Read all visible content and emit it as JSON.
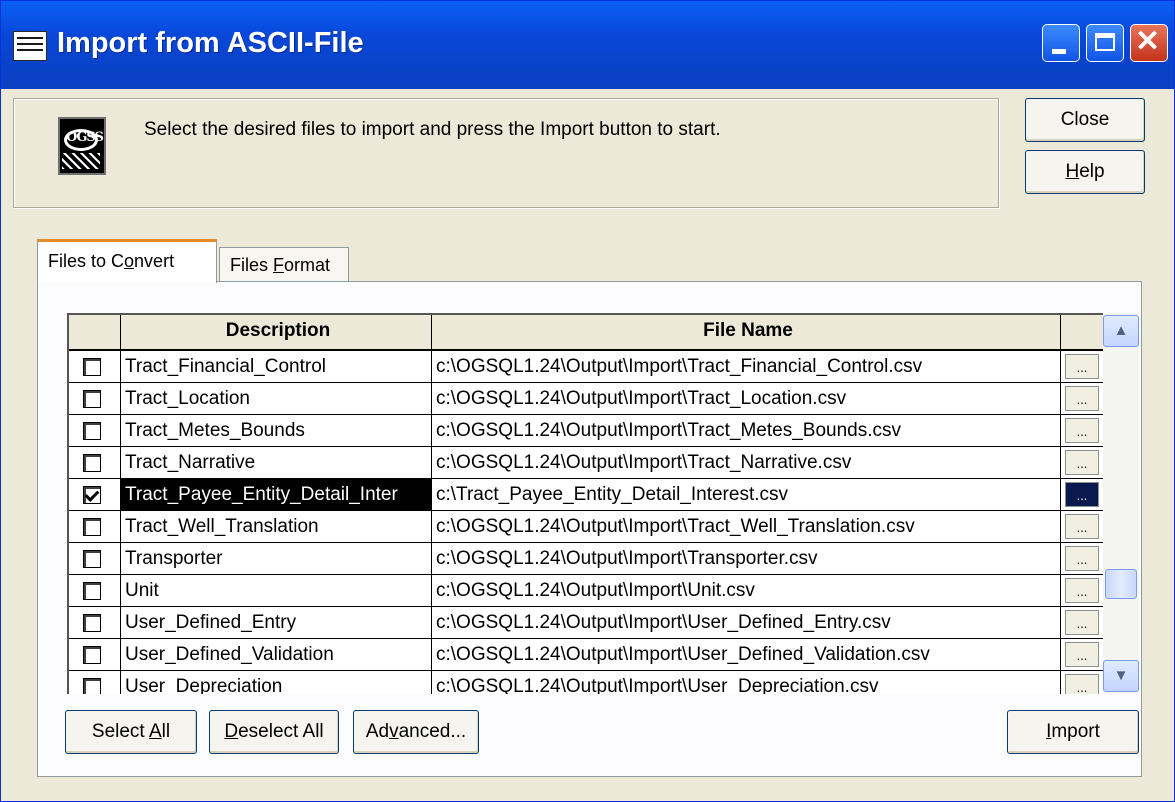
{
  "window": {
    "title": "Import from ASCII-File"
  },
  "instructions": "Select the desired files to import and press the Import button to start.",
  "buttons": {
    "close": "Close",
    "help": "Help",
    "select_all": "Select All",
    "deselect_all": "Deselect All",
    "advanced": "Advanced...",
    "import": "Import"
  },
  "tabs": [
    {
      "label": "Files to Convert",
      "active": true
    },
    {
      "label": "Files Format",
      "active": false
    }
  ],
  "table": {
    "headers": {
      "check": "",
      "description": "Description",
      "file_name": "File Name",
      "browse": ""
    },
    "browse_label": "...",
    "rows": [
      {
        "checked": false,
        "description": "Tract_Financial_Control",
        "file": "c:\\OGSQL1.24\\Output\\Import\\Tract_Financial_Control.csv",
        "selected": false
      },
      {
        "checked": false,
        "description": "Tract_Location",
        "file": "c:\\OGSQL1.24\\Output\\Import\\Tract_Location.csv",
        "selected": false
      },
      {
        "checked": false,
        "description": "Tract_Metes_Bounds",
        "file": "c:\\OGSQL1.24\\Output\\Import\\Tract_Metes_Bounds.csv",
        "selected": false
      },
      {
        "checked": false,
        "description": "Tract_Narrative",
        "file": "c:\\OGSQL1.24\\Output\\Import\\Tract_Narrative.csv",
        "selected": false
      },
      {
        "checked": true,
        "description": "Tract_Payee_Entity_Detail_Inter",
        "file": "c:\\Tract_Payee_Entity_Detail_Interest.csv",
        "selected": true
      },
      {
        "checked": false,
        "description": "Tract_Well_Translation",
        "file": "c:\\OGSQL1.24\\Output\\Import\\Tract_Well_Translation.csv",
        "selected": false
      },
      {
        "checked": false,
        "description": "Transporter",
        "file": "c:\\OGSQL1.24\\Output\\Import\\Transporter.csv",
        "selected": false
      },
      {
        "checked": false,
        "description": "Unit",
        "file": "c:\\OGSQL1.24\\Output\\Import\\Unit.csv",
        "selected": false
      },
      {
        "checked": false,
        "description": "User_Defined_Entry",
        "file": "c:\\OGSQL1.24\\Output\\Import\\User_Defined_Entry.csv",
        "selected": false
      },
      {
        "checked": false,
        "description": "User_Defined_Validation",
        "file": "c:\\OGSQL1.24\\Output\\Import\\User_Defined_Validation.csv",
        "selected": false
      },
      {
        "checked": false,
        "description": "User_Depreciation",
        "file": "c:\\OGSQL1.24\\Output\\Import\\User_Depreciation.csv",
        "selected": false
      }
    ]
  },
  "colors": {
    "titlebar": "#0a5ff5",
    "selection": "#000000",
    "face": "#ece9d8"
  }
}
